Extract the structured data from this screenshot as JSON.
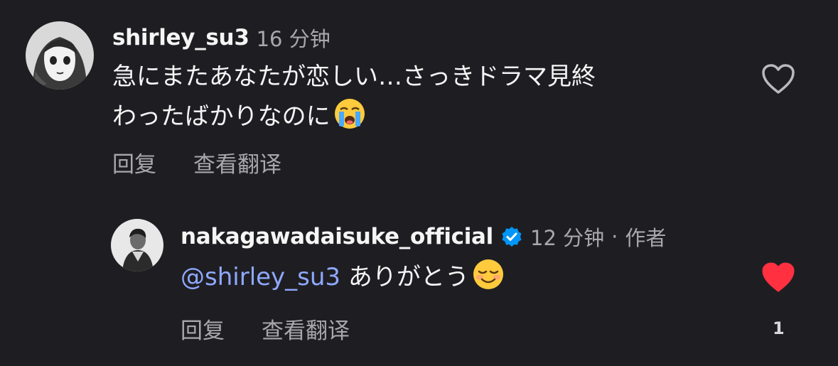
{
  "comments": [
    {
      "username": "shirley_su3",
      "time": "16 分钟",
      "text_lines": [
        "急にまたあなたが恋しい…さっきドラマ見終",
        "わったばかりなのに"
      ],
      "emoji": "loudly-crying-face",
      "actions": {
        "reply": "回复",
        "translate": "查看翻译"
      },
      "liked": false
    },
    {
      "username": "nakagawadaisuke_official",
      "verified": true,
      "time": "12 分钟",
      "separator": "·",
      "author_tag": "作者",
      "mention": "@shirley_su3",
      "text": " ありがとう",
      "emoji": "smiling-face",
      "actions": {
        "reply": "回复",
        "translate": "查看翻译"
      },
      "liked": true,
      "like_count": "1"
    }
  ],
  "colors": {
    "background": "#1e1e22",
    "username": "#f5f5f5",
    "meta": "#a7a7ad",
    "mention": "#8fa8ff",
    "heart_liked": "#ff3040",
    "verified_badge": "#0095f6"
  }
}
